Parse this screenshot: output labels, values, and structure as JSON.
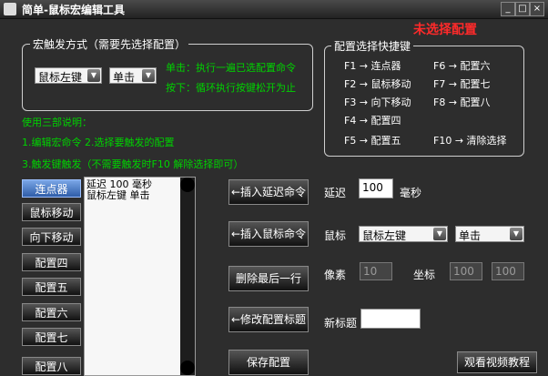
{
  "window": {
    "title": "简单-鼠标宏编辑工具",
    "min": "_",
    "max": "□",
    "close": "×"
  },
  "status_hint": "未选择配置",
  "trigger": {
    "legend": "宏触发方式（需要先选择配置）",
    "key": "鼠标左键",
    "action": "单击",
    "desc1": "单击：执行一遍已选配置命令",
    "desc2": "按下：循环执行按键松开为止"
  },
  "usage": {
    "title": "使用三部说明：",
    "step1": "1.编辑宏命令  2.选择要触发的配置",
    "step2": "3.触发键触发（不需要触发时F10 解除选择即可）"
  },
  "hotkeys": {
    "legend": "配置选择快捷键",
    "items": [
      "F1 → 连点器",
      "F6 → 配置六",
      "F2 → 鼠标移动",
      "F7 → 配置七",
      "F3 → 向下移动",
      "F8 → 配置八",
      "F4 → 配置四",
      "F5 → 配置五",
      "F10 → 清除选择"
    ]
  },
  "configs": [
    "连点器",
    "鼠标移动",
    "向下移动",
    "配置四",
    "配置五",
    "配置六",
    "配置七",
    "配置八"
  ],
  "command_list": [
    "延迟 100 毫秒",
    "鼠标左键 单击"
  ],
  "buttons": {
    "insert_delay": "←插入延迟命令",
    "insert_mouse": "←插入鼠标命令",
    "delete_last": "删除最后一行",
    "edit_title": "←修改配置标题",
    "save": "保存配置",
    "video": "观看视频教程"
  },
  "form": {
    "delay_label": "延迟",
    "delay_value": "100",
    "delay_unit": "毫秒",
    "mouse_label": "鼠标",
    "mouse_key": "鼠标左键",
    "mouse_action": "单击",
    "pixel_label": "像素",
    "pixel_value": "10",
    "coord_label": "坐标",
    "coord_x": "100",
    "coord_y": "100",
    "new_title_label": "新标题",
    "new_title_value": ""
  }
}
